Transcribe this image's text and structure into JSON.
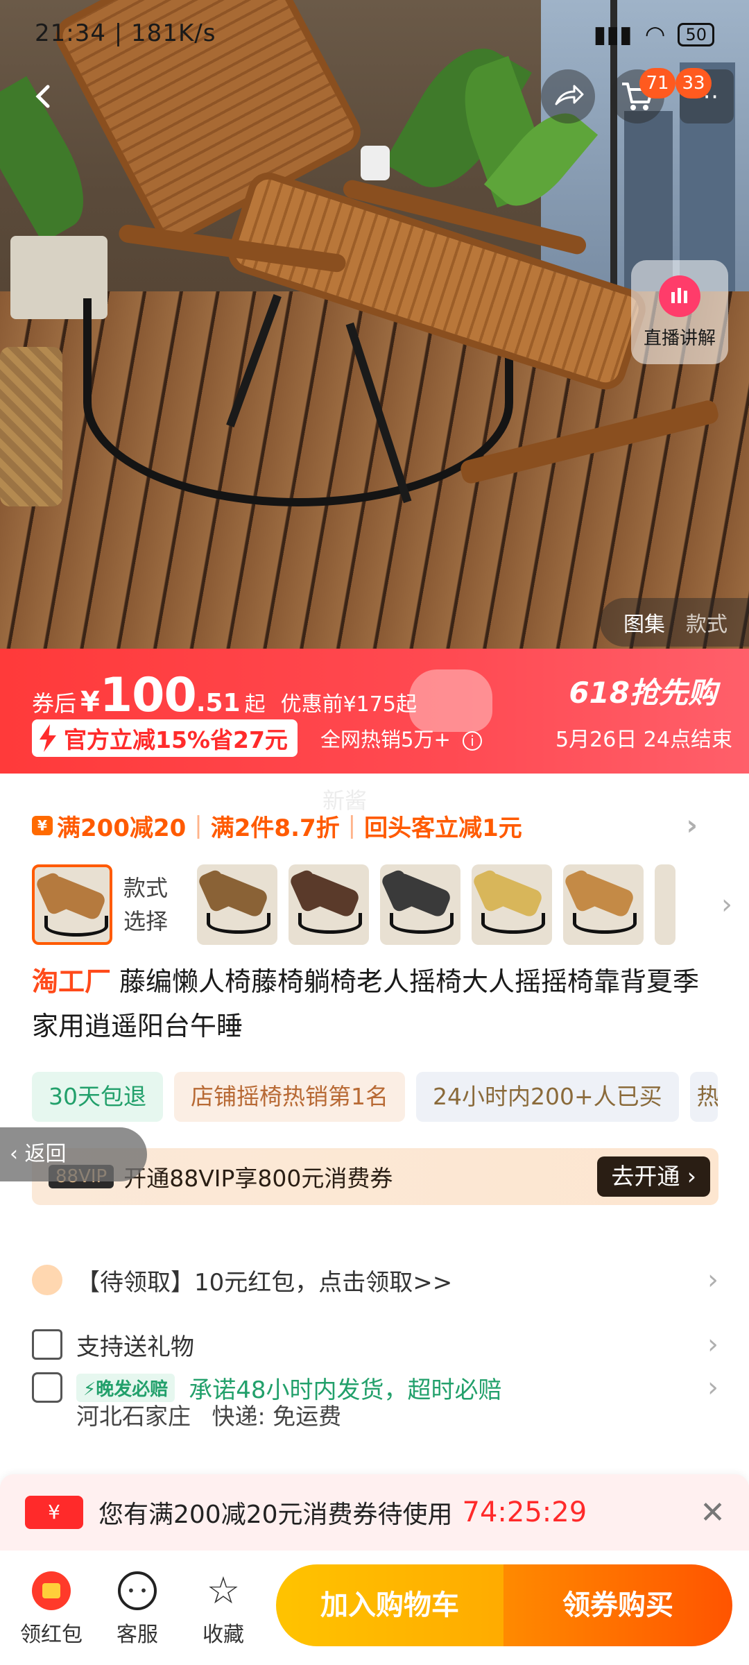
{
  "status_bar": {
    "time": "21:34 | 181K/s",
    "battery": "50"
  },
  "header": {
    "cart_badge": "71",
    "more_badge": "33"
  },
  "hero": {
    "live_label": "直播讲解",
    "tab_gallery": "图集",
    "tab_style": "款式"
  },
  "price": {
    "coupon_after": "券后",
    "currency": "¥",
    "int": "100",
    "dec": ".51",
    "qi": "起",
    "pre_price": "优惠前¥175起",
    "official_off": "官方立减15%省27元",
    "hot_sales": "全网热销5万+",
    "promo_title": "618抢先购",
    "promo_end": "5月26日 24点结束"
  },
  "details": {
    "watermark": "新酱",
    "coupons": {
      "c1": "满200减20",
      "c2": "满2件8.7折",
      "c3": "回头客立减1元"
    },
    "variant_label": "款式选择",
    "variants_colors": [
      "#b57a3e",
      "#8a6236",
      "#5a3a2a",
      "#3a3a3a",
      "#d8b65a",
      "#c48a46",
      "#a87040"
    ],
    "brand": "淘工厂",
    "title": "藤编懒人椅藤椅躺椅老人摇椅大人摇摇椅靠背夏季家用逍遥阳台午睡",
    "tags": [
      "30天包退",
      "店铺摇椅热销第1名",
      "24小时内200+人已买",
      "热"
    ],
    "back": "返回",
    "vip": {
      "badge": "88VIP",
      "text": "开通88VIP享800元消费券",
      "button": "去开通"
    },
    "red_packet": "【待领取】10元红包，点击领取>>",
    "gift": "支持送礼物",
    "late_tag": "晚发必赔",
    "ship_promise": "承诺48小时内发货，超时必赔",
    "ship_from": "河北石家庄",
    "express": "快递: 免运费"
  },
  "notice": {
    "text": "您有满200减20元消费券待使用",
    "countdown": "74:25:29"
  },
  "bottom_bar": {
    "red_packet": "领红包",
    "service": "客服",
    "favorite": "收藏",
    "add_cart": "加入购物车",
    "buy": "领券购买"
  }
}
